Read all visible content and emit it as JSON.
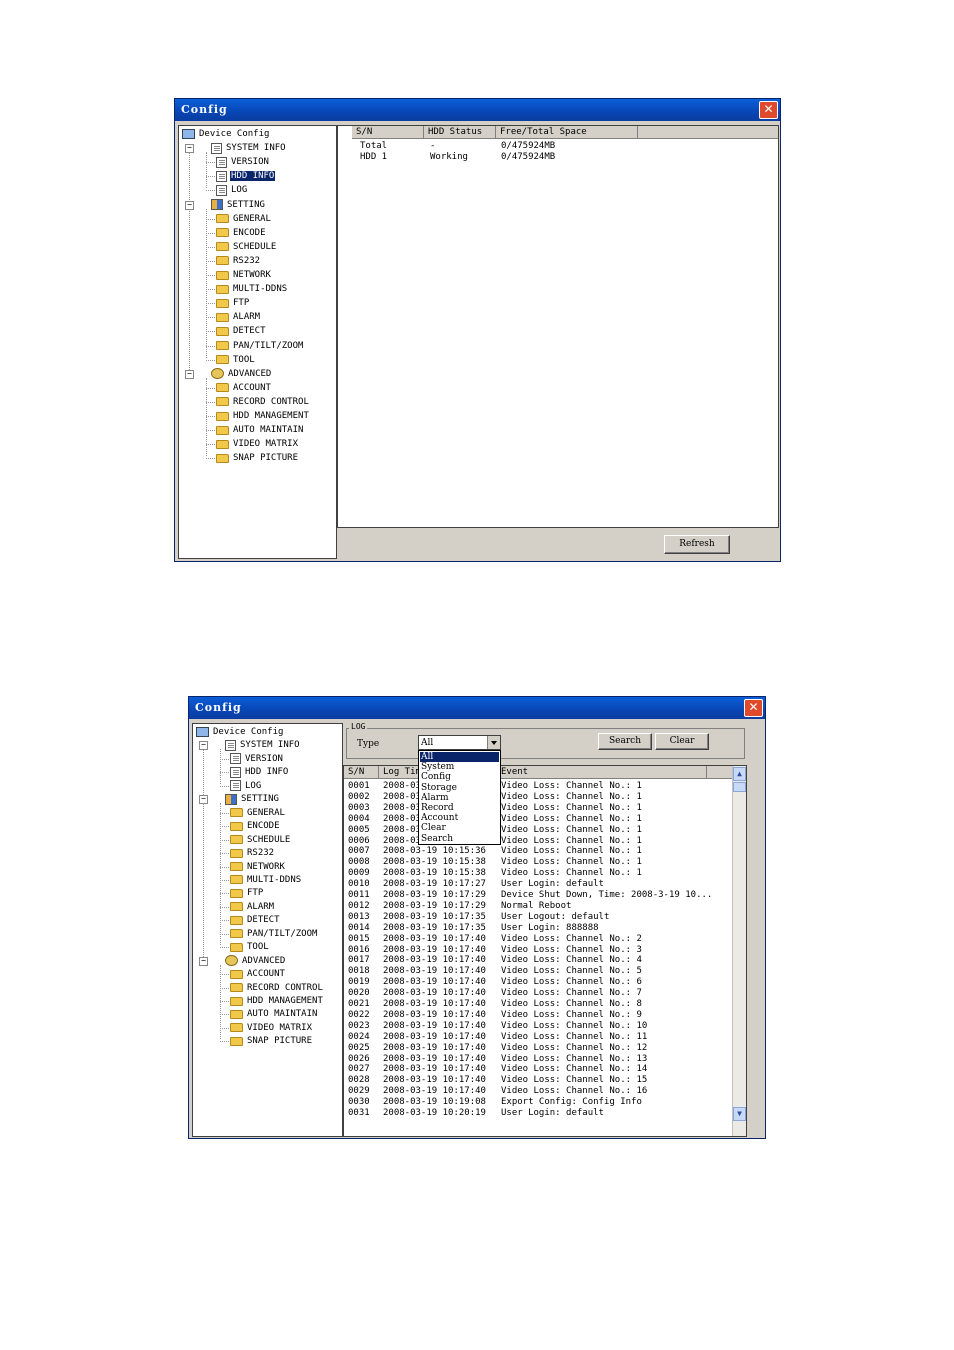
{
  "window1": {
    "title": "Config",
    "tree": {
      "root": "Device Config",
      "system_info": "SYSTEM INFO",
      "version": "VERSION",
      "hdd_info": "HDD INFO",
      "log": "LOG",
      "setting": "SETTING",
      "general": "GENERAL",
      "encode": "ENCODE",
      "schedule": "SCHEDULE",
      "rs232": "RS232",
      "network": "NETWORK",
      "multi_ddns": "MULTI-DDNS",
      "ftp": "FTP",
      "alarm": "ALARM",
      "detect": "DETECT",
      "pan_tilt_zoom": "PAN/TILT/ZOOM",
      "tool": "TOOL",
      "advanced": "ADVANCED",
      "account": "ACCOUNT",
      "record_control": "RECORD CONTROL",
      "hdd_management": "HDD MANAGEMENT",
      "auto_maintain": "AUTO MAINTAIN",
      "video_matrix": "VIDEO MATRIX",
      "snap_picture": "SNAP PICTURE"
    },
    "table": {
      "col_sn": "S/N",
      "col_status": "HDD Status",
      "col_space": "Free/Total Space",
      "rows": [
        {
          "sn": "Total",
          "status": "-",
          "space": "0/475924MB"
        },
        {
          "sn": "HDD 1",
          "status": "Working",
          "space": "0/475924MB"
        }
      ]
    },
    "refresh_label": "Refresh"
  },
  "window2": {
    "title": "Config",
    "tree": {
      "root": "Device Config",
      "system_info": "SYSTEM INFO",
      "version": "VERSION",
      "hdd_info": "HDD INFO",
      "log": "LOG",
      "setting": "SETTING",
      "general": "GENERAL",
      "encode": "ENCODE",
      "schedule": "SCHEDULE",
      "rs232": "RS232",
      "network": "NETWORK",
      "multi_ddns": "MULTI-DDNS",
      "ftp": "FTP",
      "alarm": "ALARM",
      "detect": "DETECT",
      "pan_tilt_zoom": "PAN/TILT/ZOOM",
      "tool": "TOOL",
      "advanced": "ADVANCED",
      "account": "ACCOUNT",
      "record_control": "RECORD CONTROL",
      "hdd_management": "HDD MANAGEMENT",
      "auto_maintain": "AUTO MAINTAIN",
      "video_matrix": "VIDEO MATRIX",
      "snap_picture": "SNAP PICTURE"
    },
    "group_label": "LOG",
    "type_label": "Type",
    "type_value": "All",
    "search_label": "Search",
    "clear_label": "Clear",
    "type_options": [
      "All",
      "System",
      "Config",
      "Storage",
      "Alarm",
      "Record",
      "Account",
      "Clear",
      "Search"
    ],
    "col_sn": "S/N",
    "col_time": "Log Time",
    "col_event": "Event",
    "log_rows": [
      {
        "sn": "0001",
        "time": "2008-03",
        "event": "Video Loss: Channel No.: 1"
      },
      {
        "sn": "0002",
        "time": "2008-03",
        "event": "Video Loss: Channel No.: 1"
      },
      {
        "sn": "0003",
        "time": "2008-03",
        "event": "Video Loss: Channel No.: 1"
      },
      {
        "sn": "0004",
        "time": "2008-03",
        "event": "Video Loss: Channel No.: 1"
      },
      {
        "sn": "0005",
        "time": "2008-03",
        "event": "Video Loss: Channel No.: 1"
      },
      {
        "sn": "0006",
        "time": "2008-03",
        "event": "Video Loss: Channel No.: 1"
      },
      {
        "sn": "0007",
        "time": "2008-03-19 10:15:36",
        "event": "Video Loss: Channel No.: 1"
      },
      {
        "sn": "0008",
        "time": "2008-03-19 10:15:38",
        "event": "Video Loss: Channel No.: 1"
      },
      {
        "sn": "0009",
        "time": "2008-03-19 10:15:38",
        "event": "Video Loss: Channel No.: 1"
      },
      {
        "sn": "0010",
        "time": "2008-03-19 10:17:27",
        "event": "User Login: default"
      },
      {
        "sn": "0011",
        "time": "2008-03-19 10:17:29",
        "event": "Device Shut Down, Time: 2008-3-19 10..."
      },
      {
        "sn": "0012",
        "time": "2008-03-19 10:17:29",
        "event": "Normal Reboot"
      },
      {
        "sn": "0013",
        "time": "2008-03-19 10:17:35",
        "event": "User Logout: default"
      },
      {
        "sn": "0014",
        "time": "2008-03-19 10:17:35",
        "event": "User Login: 888888"
      },
      {
        "sn": "0015",
        "time": "2008-03-19 10:17:40",
        "event": "Video Loss: Channel No.: 2"
      },
      {
        "sn": "0016",
        "time": "2008-03-19 10:17:40",
        "event": "Video Loss: Channel No.: 3"
      },
      {
        "sn": "0017",
        "time": "2008-03-19 10:17:40",
        "event": "Video Loss: Channel No.: 4"
      },
      {
        "sn": "0018",
        "time": "2008-03-19 10:17:40",
        "event": "Video Loss: Channel No.: 5"
      },
      {
        "sn": "0019",
        "time": "2008-03-19 10:17:40",
        "event": "Video Loss: Channel No.: 6"
      },
      {
        "sn": "0020",
        "time": "2008-03-19 10:17:40",
        "event": "Video Loss: Channel No.: 7"
      },
      {
        "sn": "0021",
        "time": "2008-03-19 10:17:40",
        "event": "Video Loss: Channel No.: 8"
      },
      {
        "sn": "0022",
        "time": "2008-03-19 10:17:40",
        "event": "Video Loss: Channel No.: 9"
      },
      {
        "sn": "0023",
        "time": "2008-03-19 10:17:40",
        "event": "Video Loss: Channel No.: 10"
      },
      {
        "sn": "0024",
        "time": "2008-03-19 10:17:40",
        "event": "Video Loss: Channel No.: 11"
      },
      {
        "sn": "0025",
        "time": "2008-03-19 10:17:40",
        "event": "Video Loss: Channel No.: 12"
      },
      {
        "sn": "0026",
        "time": "2008-03-19 10:17:40",
        "event": "Video Loss: Channel No.: 13"
      },
      {
        "sn": "0027",
        "time": "2008-03-19 10:17:40",
        "event": "Video Loss: Channel No.: 14"
      },
      {
        "sn": "0028",
        "time": "2008-03-19 10:17:40",
        "event": "Video Loss: Channel No.: 15"
      },
      {
        "sn": "0029",
        "time": "2008-03-19 10:17:40",
        "event": "Video Loss: Channel No.: 16"
      },
      {
        "sn": "0030",
        "time": "2008-03-19 10:19:08",
        "event": "Export Config: Config Info"
      },
      {
        "sn": "0031",
        "time": "2008-03-19 10:20:19",
        "event": "User Login: default"
      }
    ]
  }
}
